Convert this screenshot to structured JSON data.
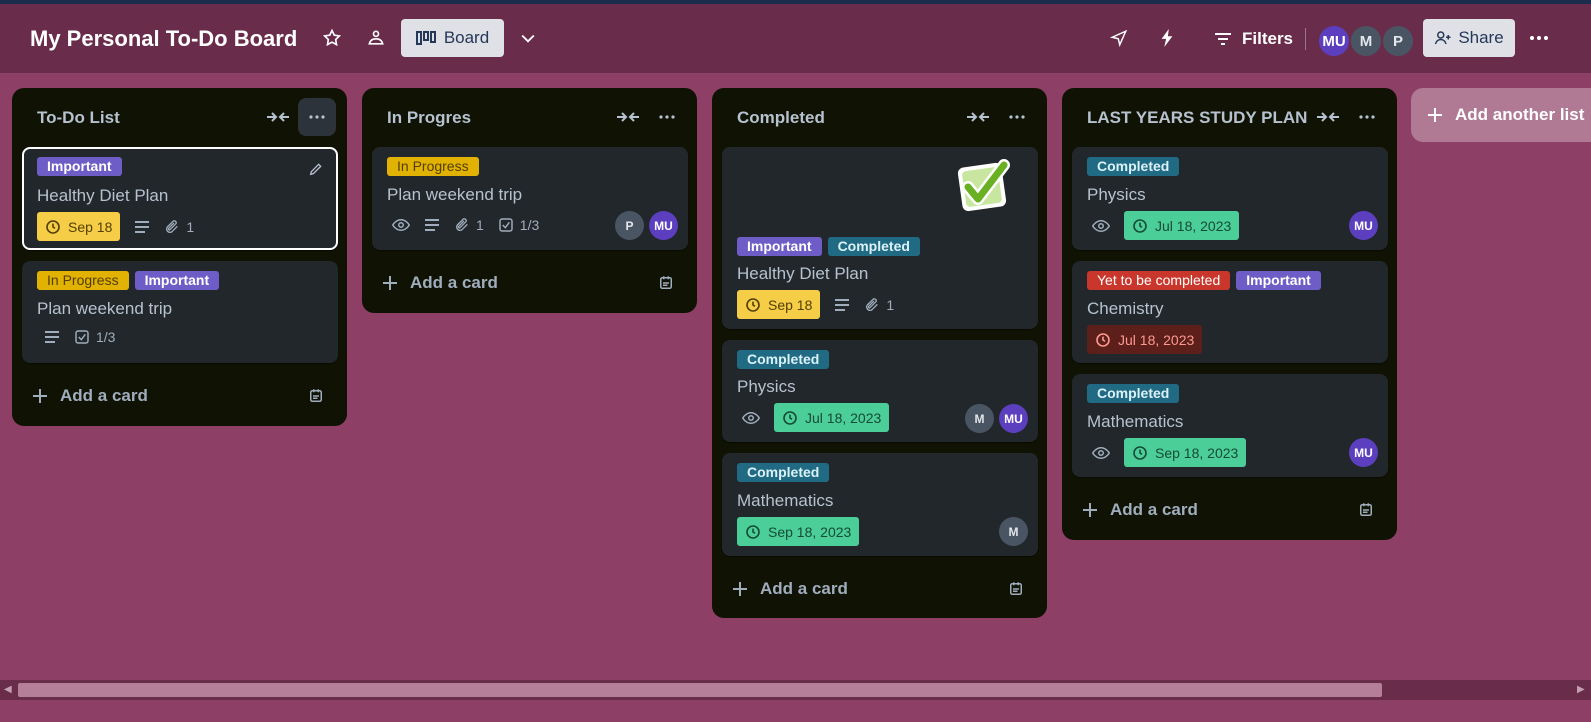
{
  "header": {
    "title": "My Personal To-Do Board",
    "view_label": "Board",
    "filters_label": "Filters",
    "share_label": "Share",
    "members": [
      "MU",
      "M",
      "P"
    ]
  },
  "lists": [
    {
      "title": "To-Do List",
      "cards": [
        {
          "labels": [
            "Important"
          ],
          "title": "Healthy Diet Plan",
          "due": "Sep 18",
          "attachments": "1"
        },
        {
          "labels": [
            "In Progress",
            "Important"
          ],
          "title": "Plan weekend trip",
          "checklist": "1/3"
        }
      ],
      "add_card": "Add a card"
    },
    {
      "title": "In Progres",
      "cards": [
        {
          "labels": [
            "In Progress"
          ],
          "title": "Plan weekend trip",
          "attachments": "1",
          "checklist": "1/3",
          "members": [
            "P",
            "MU"
          ]
        }
      ],
      "add_card": "Add a card"
    },
    {
      "title": "Completed",
      "cards": [
        {
          "labels": [
            "Important",
            "Completed"
          ],
          "title": "Healthy Diet Plan",
          "due": "Sep 18",
          "attachments": "1"
        },
        {
          "labels": [
            "Completed"
          ],
          "title": "Physics",
          "due": "Jul 18, 2023",
          "members": [
            "M",
            "MU"
          ]
        },
        {
          "labels": [
            "Completed"
          ],
          "title": "Mathematics",
          "due": "Sep 18, 2023",
          "members": [
            "M"
          ]
        }
      ],
      "add_card": "Add a card"
    },
    {
      "title": "LAST YEARS STUDY PLAN",
      "cards": [
        {
          "labels": [
            "Completed"
          ],
          "title": "Physics",
          "due": "Jul 18, 2023",
          "members": [
            "MU"
          ]
        },
        {
          "labels": [
            "Yet to be completed",
            "Important"
          ],
          "title": "Chemistry",
          "due": "Jul 18, 2023"
        },
        {
          "labels": [
            "Completed"
          ],
          "title": "Mathematics",
          "due": "Sep 18, 2023",
          "members": [
            "MU"
          ]
        }
      ],
      "add_card": "Add a card"
    }
  ],
  "add_list": "Add another list",
  "colors": {
    "board_bg": "#8e3f66",
    "header_bg": "#6a2c4b",
    "list_bg": "#101204",
    "card_bg": "#22272b",
    "label_important": "#6e5dc6",
    "label_in_progress": "#e2b203",
    "label_completed": "#206a83",
    "label_yet_to_be_completed": "#c9372c",
    "due_green": "#4bce97",
    "due_yellow": "#f5cd47",
    "due_red": "#5d1f1a"
  }
}
